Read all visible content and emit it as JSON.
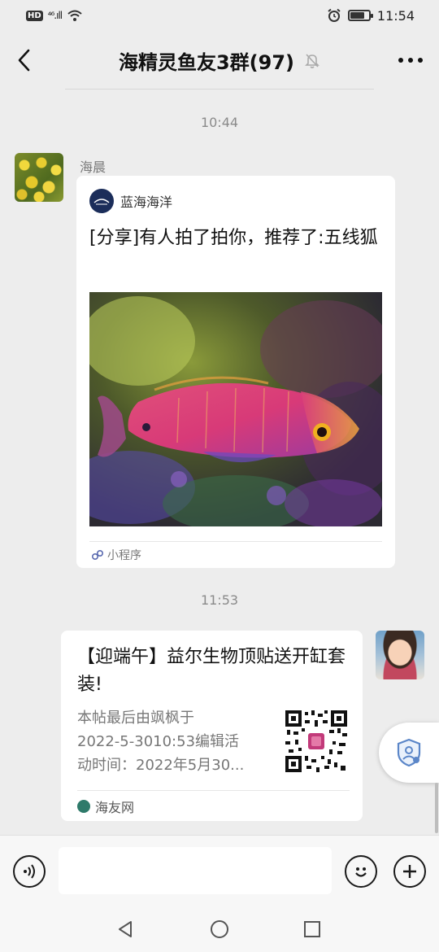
{
  "status_bar": {
    "left": "HD",
    "signal": "⁴⁶.ıll",
    "time": "11:54"
  },
  "header": {
    "title": "海精灵鱼友3群(97)"
  },
  "messages": [
    {
      "type": "timestamp",
      "text": "10:44"
    },
    {
      "type": "mini_program_card",
      "sender": "海晨",
      "source": "蓝海海洋",
      "title": "[分享]有人拍了拍你，推荐了:五线狐",
      "footer": "小程序"
    },
    {
      "type": "timestamp",
      "text": "11:53"
    },
    {
      "type": "link_card",
      "title": "【迎端午】益尔生物顶贴送开缸套装!",
      "desc_lines": [
        "本帖最后由飒枫于",
        "2022-5-3010:53编辑活",
        "动时间：2022年5月30..."
      ],
      "footer": "海友网"
    }
  ],
  "icons": {
    "back": "chevron-left-icon",
    "more": "more-dots-icon",
    "mute": "bell-muted-icon",
    "voice": "voice-icon",
    "emoji": "emoji-icon",
    "plus": "plus-circle-icon",
    "badge": "shield-icon"
  },
  "input": {
    "placeholder": ""
  }
}
